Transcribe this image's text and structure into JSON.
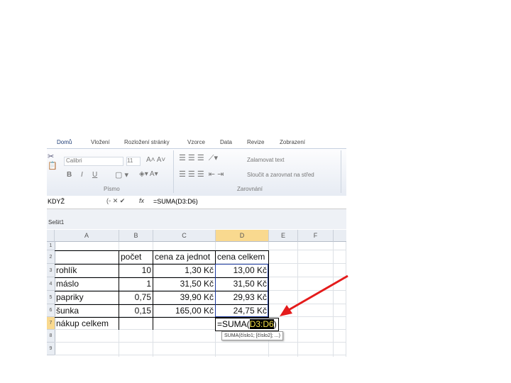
{
  "ribbon": {
    "tabs": [
      "Domů",
      "Vložení",
      "Rozložení stránky",
      "Vzorce",
      "Data",
      "Revize",
      "Zobrazení"
    ],
    "font_name": "Calibri",
    "font_size": "11",
    "bold": "B",
    "italic": "I",
    "underline": "U",
    "wrap_text": "Zalamovat text",
    "merge_center": "Sloučit a zarovnat na střed",
    "group_font": "Písmo",
    "group_align": "Zarovnání"
  },
  "formula_bar": {
    "name_box": "KDYŽ",
    "fx": "fx",
    "formula": "=SUMA(D3:D6)"
  },
  "workbook": {
    "title": "Sešit1"
  },
  "columns": [
    "A",
    "B",
    "C",
    "D",
    "E",
    "F"
  ],
  "rows": [
    "1",
    "2",
    "3",
    "4",
    "5",
    "6",
    "7",
    "8",
    "9"
  ],
  "table": {
    "header": [
      "",
      "počet",
      "cena za jednot",
      "cena celkem"
    ],
    "items": [
      [
        "rohlík",
        "10",
        "1,30 Kč",
        "13,00 Kč"
      ],
      [
        "máslo",
        "1",
        "31,50 Kč",
        "31,50 Kč"
      ],
      [
        "papriky",
        "0,75",
        "39,90 Kč",
        "29,93 Kč"
      ],
      [
        "šunka",
        "0,15",
        "165,00 Kč",
        "24,75 Kč"
      ]
    ],
    "total_label": "nákup celkem"
  },
  "edit": {
    "prefix": "=SUMA(",
    "range": "D3:D6",
    "suffix": ")",
    "tooltip": "SUMA(číslo1; [číslo2]; ...)"
  },
  "colors": {
    "arrow": "#e41b1b",
    "selection": "#1f3c9e"
  }
}
